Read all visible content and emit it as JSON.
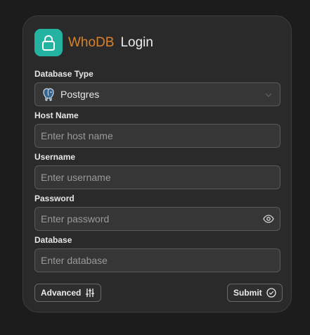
{
  "header": {
    "brand": "WhoDB",
    "title": "Login",
    "logo_icon": "lock-icon",
    "logo_color": "#25b3a1",
    "brand_color": "#d9822b"
  },
  "form": {
    "database_type": {
      "label": "Database Type",
      "value": "Postgres",
      "icon": "postgres-elephant-icon"
    },
    "host_name": {
      "label": "Host Name",
      "placeholder": "Enter host name",
      "value": ""
    },
    "username": {
      "label": "Username",
      "placeholder": "Enter username",
      "value": ""
    },
    "password": {
      "label": "Password",
      "placeholder": "Enter password",
      "value": "",
      "toggle_icon": "eye-icon"
    },
    "database": {
      "label": "Database",
      "placeholder": "Enter database",
      "value": ""
    }
  },
  "actions": {
    "advanced_label": "Advanced",
    "advanced_icon": "sliders-icon",
    "submit_label": "Submit",
    "submit_icon": "check-circle-icon"
  }
}
